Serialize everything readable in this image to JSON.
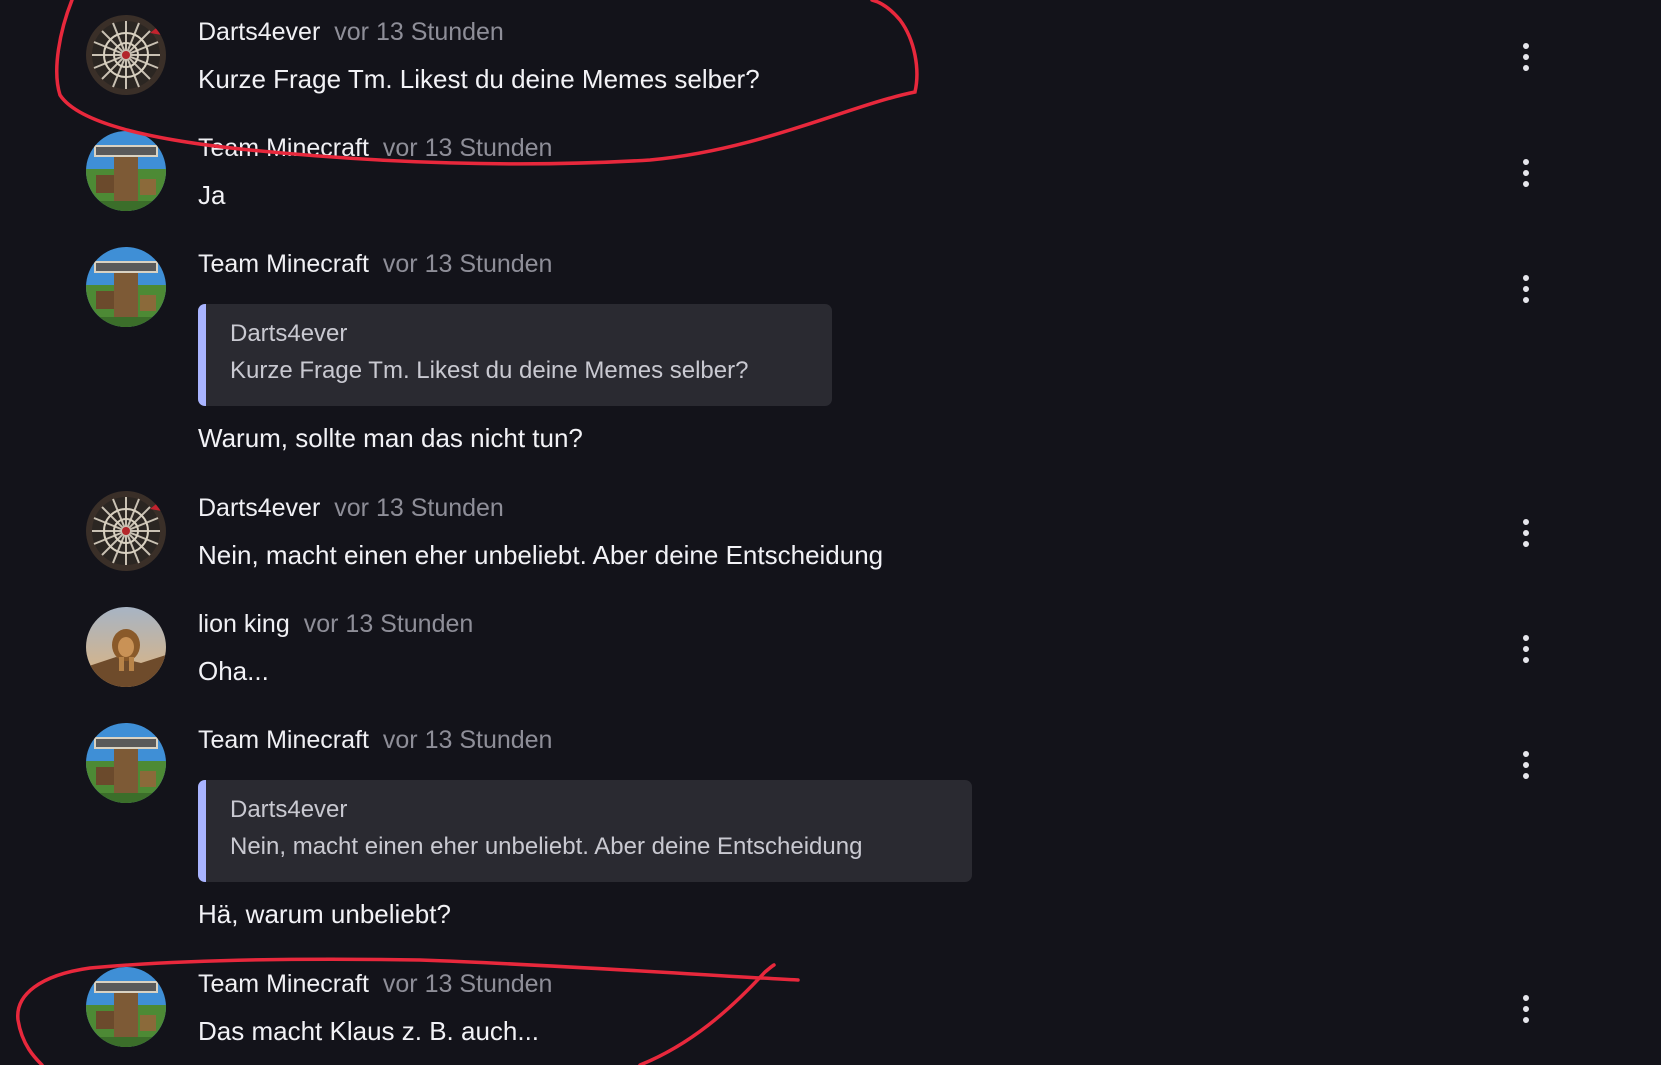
{
  "messages": [
    {
      "author": "Darts4ever",
      "time": "vor 13 Stunden",
      "text": "Kurze Frage Tm. Likest du deine Memes selber?",
      "avatar": "dartboard"
    },
    {
      "author": "Team Minecraft",
      "time": "vor 13 Stunden",
      "text": "Ja",
      "avatar": "minecraft"
    },
    {
      "author": "Team Minecraft",
      "time": "vor 13 Stunden",
      "quote_author": "Darts4ever",
      "quote_text": "Kurze Frage Tm. Likest du deine Memes selber?",
      "text": "Warum, sollte man das nicht tun?",
      "avatar": "minecraft"
    },
    {
      "author": "Darts4ever",
      "time": "vor 13 Stunden",
      "text": "Nein, macht einen eher unbeliebt. Aber deine Entscheidung",
      "avatar": "dartboard"
    },
    {
      "author": "lion king",
      "time": "vor 13 Stunden",
      "text": "Oha...",
      "avatar": "lion"
    },
    {
      "author": "Team Minecraft",
      "time": "vor 13 Stunden",
      "quote_author": "Darts4ever",
      "quote_text": "Nein, macht einen eher unbeliebt. Aber deine Entscheidung",
      "text": "Hä, warum unbeliebt?",
      "avatar": "minecraft"
    },
    {
      "author": "Team Minecraft",
      "time": "vor 13 Stunden",
      "text": "Das macht Klaus z. B. auch...",
      "avatar": "minecraft"
    }
  ],
  "icons": {
    "more": "more-vertical-icon"
  },
  "colors": {
    "background": "#13131a",
    "quote_bg": "#2a2a31",
    "quote_bar": "#a9b4ff",
    "annotation": "#e8283c"
  }
}
